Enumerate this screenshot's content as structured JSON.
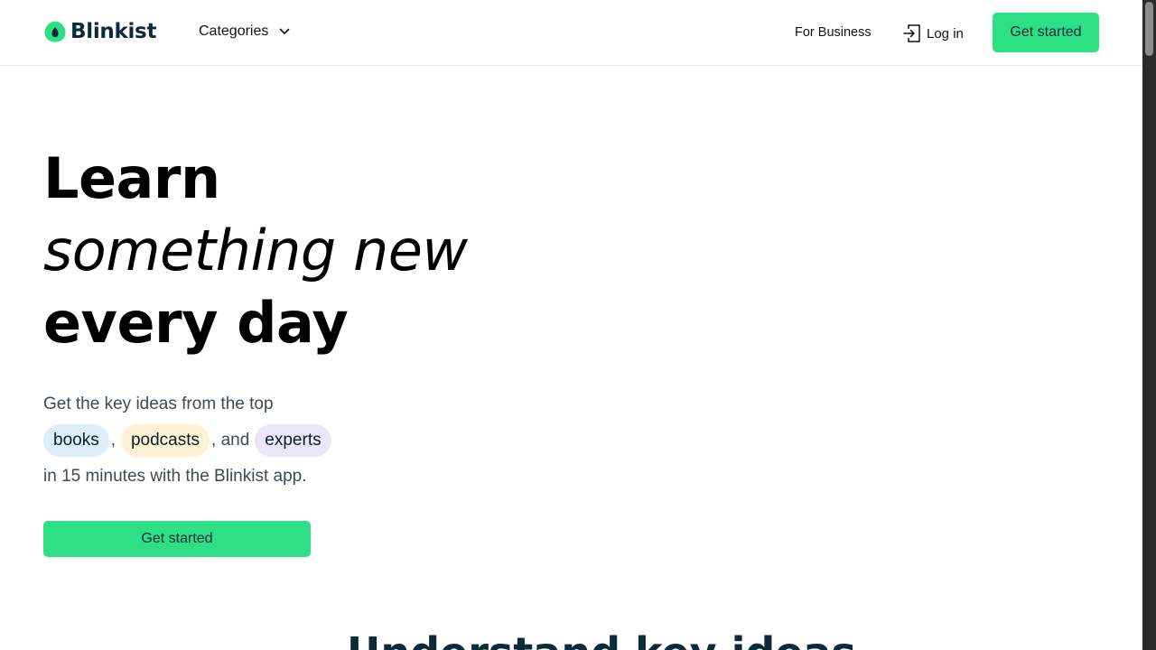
{
  "header": {
    "logo_text": "Blinkist",
    "categories_label": "Categories",
    "for_business_label": "For Business",
    "login_label": "Log in",
    "cta_label": "Get started"
  },
  "hero": {
    "line1": "Learn",
    "line2": "something new",
    "line3": "every day",
    "sub_line1": "Get the key ideas from the top",
    "pill_books": "books",
    "sep1": ",",
    "pill_podcasts": "podcasts",
    "sep2": ", and",
    "pill_experts": "experts",
    "sub_line3": "in 15 minutes with the Blinkist app.",
    "cta_label": "Get started"
  },
  "next_section": {
    "title": "Understand key ideas"
  },
  "colors": {
    "accent": "#2ee085",
    "brand_dark": "#0b2a3a",
    "pill_books": "#dcedfb",
    "pill_podcasts": "#fdf2d6",
    "pill_experts": "#ebe6fb"
  },
  "icons": {
    "logo": "blinkist-logo-icon",
    "categories": "chevron-down-icon",
    "login": "login-icon"
  }
}
